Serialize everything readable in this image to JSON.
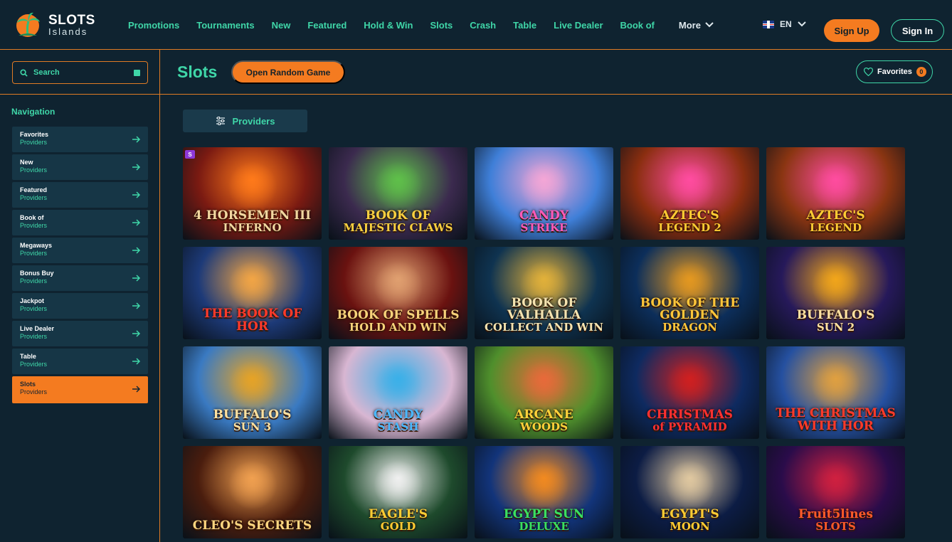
{
  "brand": {
    "line1": "SLOTS",
    "line2": "Islands"
  },
  "top_nav": [
    {
      "label": "Promotions"
    },
    {
      "label": "Tournaments"
    },
    {
      "label": "New"
    },
    {
      "label": "Featured"
    },
    {
      "label": "Hold & Win"
    },
    {
      "label": "Slots"
    },
    {
      "label": "Crash"
    },
    {
      "label": "Table"
    },
    {
      "label": "Live Dealer"
    },
    {
      "label": "Book of"
    }
  ],
  "more_label": "More",
  "language": "EN",
  "auth": {
    "signup": "Sign Up",
    "signin": "Sign In"
  },
  "search": {
    "placeholder": "Search"
  },
  "sidebar": {
    "title": "Navigation",
    "items": [
      {
        "label": "Favorites",
        "sub": "Providers"
      },
      {
        "label": "New",
        "sub": "Providers"
      },
      {
        "label": "Featured",
        "sub": "Providers"
      },
      {
        "label": "Book of",
        "sub": "Providers"
      },
      {
        "label": "Megaways",
        "sub": "Providers"
      },
      {
        "label": "Bonus Buy",
        "sub": "Providers"
      },
      {
        "label": "Jackpot",
        "sub": "Providers"
      },
      {
        "label": "Live Dealer",
        "sub": "Providers"
      },
      {
        "label": "Table",
        "sub": "Providers"
      },
      {
        "label": "Slots",
        "sub": "Providers"
      }
    ],
    "active_index": 9
  },
  "main": {
    "title": "Slots",
    "random_button": "Open Random Game",
    "favorites_label": "Favorites",
    "favorites_count": "0",
    "providers_button": "Providers"
  },
  "games": [
    {
      "title": "4 HORSEMEN III",
      "sub": "INFERNO",
      "bg": "#7a1a12",
      "glow": "#ff7a1a",
      "color": "#f2d7a0",
      "badge": "S"
    },
    {
      "title": "BOOK OF",
      "sub": "MAJESTIC CLAWS",
      "bg": "#3b2a4e",
      "glow": "#5fc04a",
      "color": "#f8d040"
    },
    {
      "title": "CANDY",
      "sub": "STRIKE",
      "bg": "#3f7fd8",
      "glow": "#f4a6d6",
      "color": "#ff5ab8"
    },
    {
      "title": "AZTEC'S",
      "sub": "LEGEND 2",
      "bg": "#8a2e10",
      "glow": "#ff4ca0",
      "color": "#ffcc33"
    },
    {
      "title": "AZTEC'S",
      "sub": "LEGEND",
      "bg": "#8a3512",
      "glow": "#ff4ca0",
      "color": "#ffcc33"
    },
    {
      "title": "THE BOOK OF HOR",
      "sub": "",
      "bg": "#1d3a78",
      "glow": "#f2a545",
      "color": "#ff3a2a"
    },
    {
      "title": "BOOK OF SPELLS",
      "sub": "HOLD AND WIN",
      "bg": "#6a1210",
      "glow": "#e0a070",
      "color": "#f7d27a"
    },
    {
      "title": "BOOK OF VALHALLA",
      "sub": "COLLECT AND WIN",
      "bg": "#0f3350",
      "glow": "#e2b13a",
      "color": "#f4e3b0"
    },
    {
      "title": "BOOK OF THE GOLDEN",
      "sub": "DRAGON",
      "bg": "#0c2e5a",
      "glow": "#e49820",
      "color": "#ffc63a"
    },
    {
      "title": "BUFFALO'S",
      "sub": "SUN 2",
      "bg": "#26195a",
      "glow": "#f2a61a",
      "color": "#ffe1a0"
    },
    {
      "title": "BUFFALO'S",
      "sub": "SUN 3",
      "bg": "#3a7ac2",
      "glow": "#e6a326",
      "color": "#ffe1a0"
    },
    {
      "title": "CANDY",
      "sub": "STASH",
      "bg": "#d8b6d2",
      "glow": "#3ab0e8",
      "color": "#4ab8ff"
    },
    {
      "title": "ARCANE",
      "sub": "WOODS",
      "bg": "#4f8f2c",
      "glow": "#e86a3a",
      "color": "#ffd23a"
    },
    {
      "title": "CHRISTMAS",
      "sub": "of PYRAMID",
      "bg": "#0e2a60",
      "glow": "#d02020",
      "color": "#ff3030"
    },
    {
      "title": "THE CHRISTMAS WITH HOR",
      "sub": "",
      "bg": "#2550a0",
      "glow": "#e0a040",
      "color": "#ff3a2a"
    },
    {
      "title": "CLEO'S SECRETS",
      "sub": "",
      "bg": "#4a1d0e",
      "glow": "#f0a050",
      "color": "#ffd680"
    },
    {
      "title": "EAGLE'S",
      "sub": "GOLD",
      "bg": "#1e4a2c",
      "glow": "#f0f0f0",
      "color": "#ffcc33"
    },
    {
      "title": "EGYPT SUN",
      "sub": "DELUXE",
      "bg": "#12347a",
      "glow": "#f28a20",
      "color": "#3ae060"
    },
    {
      "title": "EGYPT'S",
      "sub": "MOON",
      "bg": "#0c1c44",
      "glow": "#e0c8a0",
      "color": "#ffcc33"
    },
    {
      "title": "Fruit5lines",
      "sub": "SLOTS",
      "bg": "#2a0c4a",
      "glow": "#d02040",
      "color": "#ff5a2a"
    }
  ],
  "colors": {
    "accent": "#3fd6a8",
    "orange": "#f47b20",
    "bg": "#0f2330",
    "panel": "#163646"
  }
}
